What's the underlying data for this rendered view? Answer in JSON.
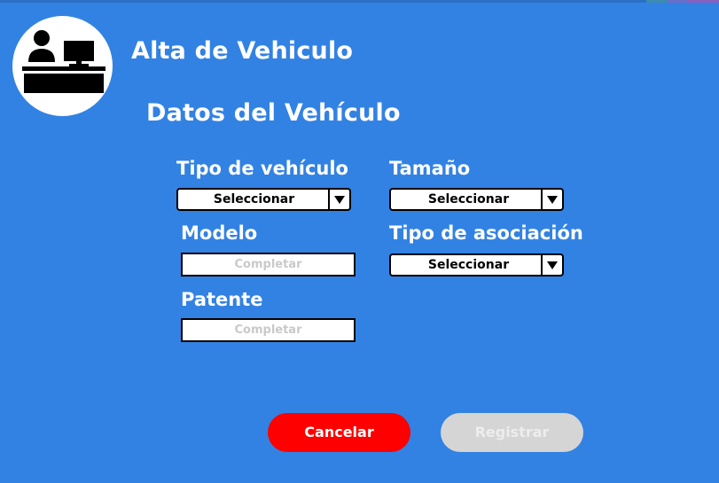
{
  "app": {
    "title": "Alta de Vehiculo",
    "logo_icon": "receptionist-desk-icon"
  },
  "form": {
    "section_title": "Datos del Vehículo",
    "tipo_vehiculo": {
      "label": "Tipo de vehículo",
      "value": "Seleccionar"
    },
    "tamano": {
      "label": "Tamaño",
      "value": "Seleccionar"
    },
    "modelo": {
      "label": "Modelo",
      "placeholder": "Completar"
    },
    "tipo_asociacion": {
      "label": "Tipo de asociación",
      "value": "Seleccionar"
    },
    "patente": {
      "label": "Patente",
      "placeholder": "Completar"
    }
  },
  "actions": {
    "cancel_label": "Cancelar",
    "register_label": "Registrar"
  },
  "colors": {
    "background": "#3282e3",
    "cancel": "#fe0000",
    "register_disabled": "#d5d5d5",
    "dropdown_arrow_icon": "triangle-down"
  }
}
